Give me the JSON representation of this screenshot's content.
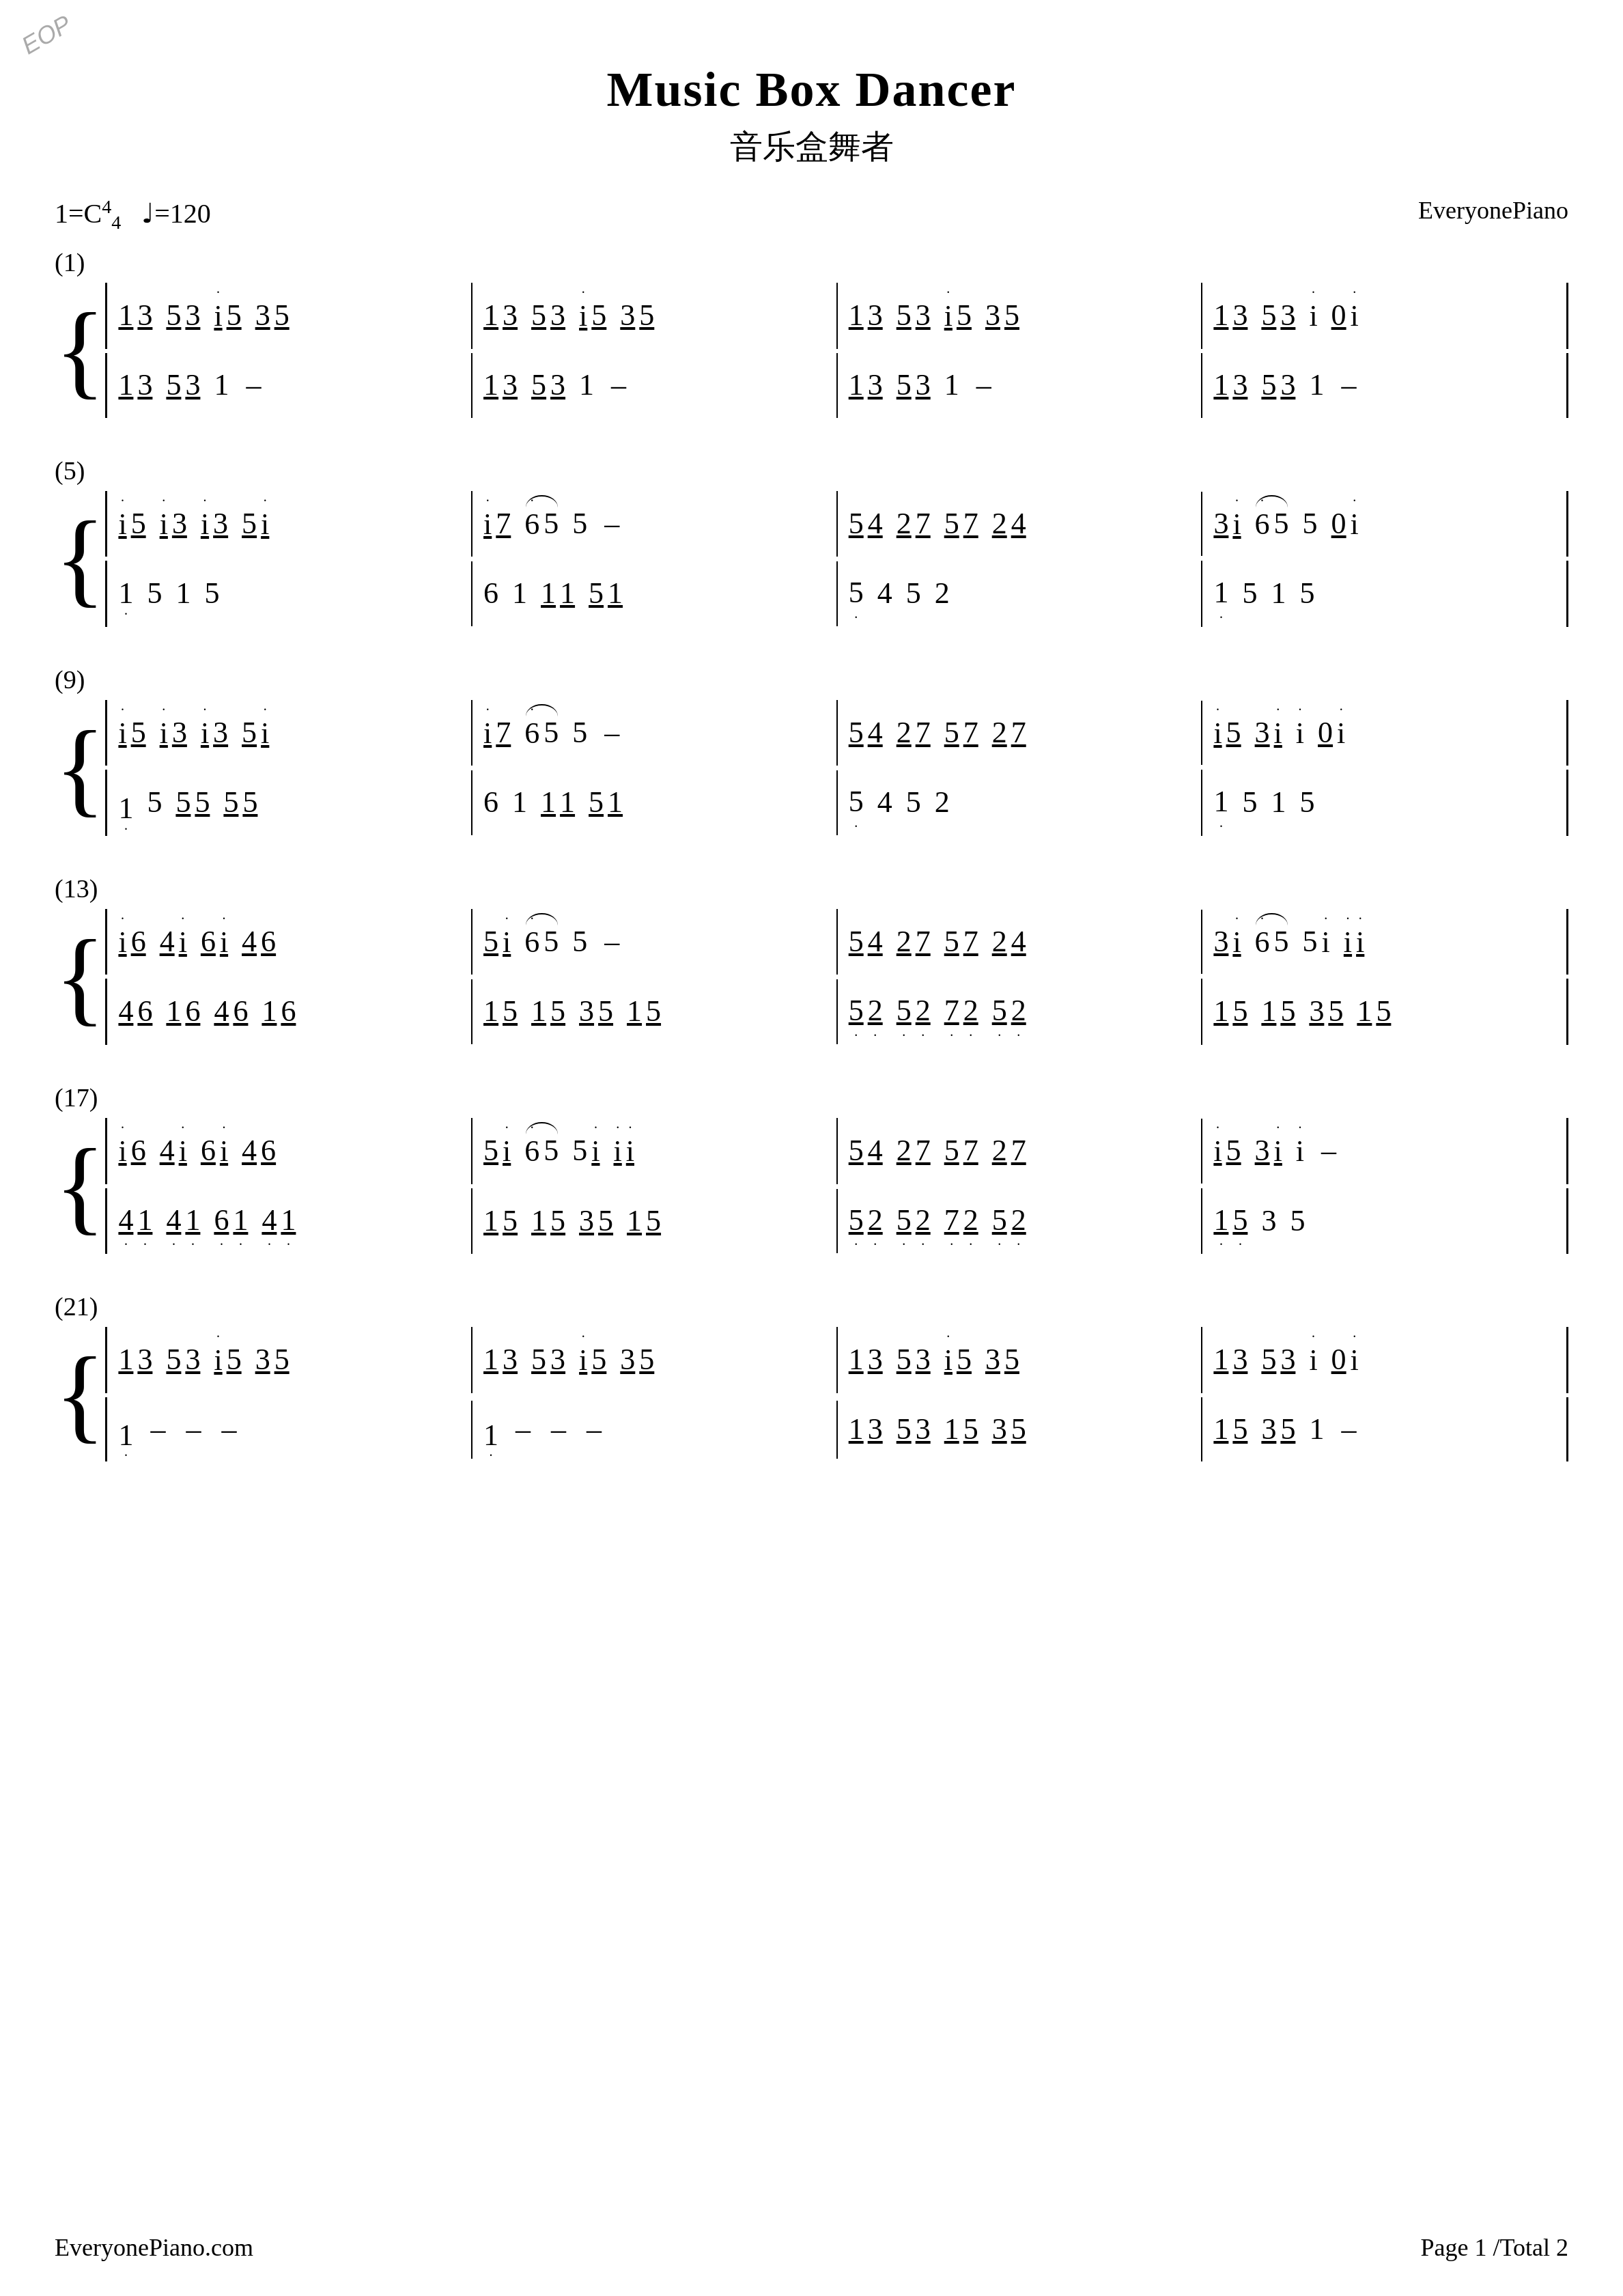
{
  "page": {
    "logo": "EOP",
    "title": "Music Box Dancer",
    "subtitle": "音乐盒舞者",
    "key": "1=C",
    "time": "4/4",
    "tempo": "♩=120",
    "source": "EveryonePiano",
    "footer_left": "EveryonePiano.com",
    "footer_right": "Page 1 /Total 2"
  }
}
